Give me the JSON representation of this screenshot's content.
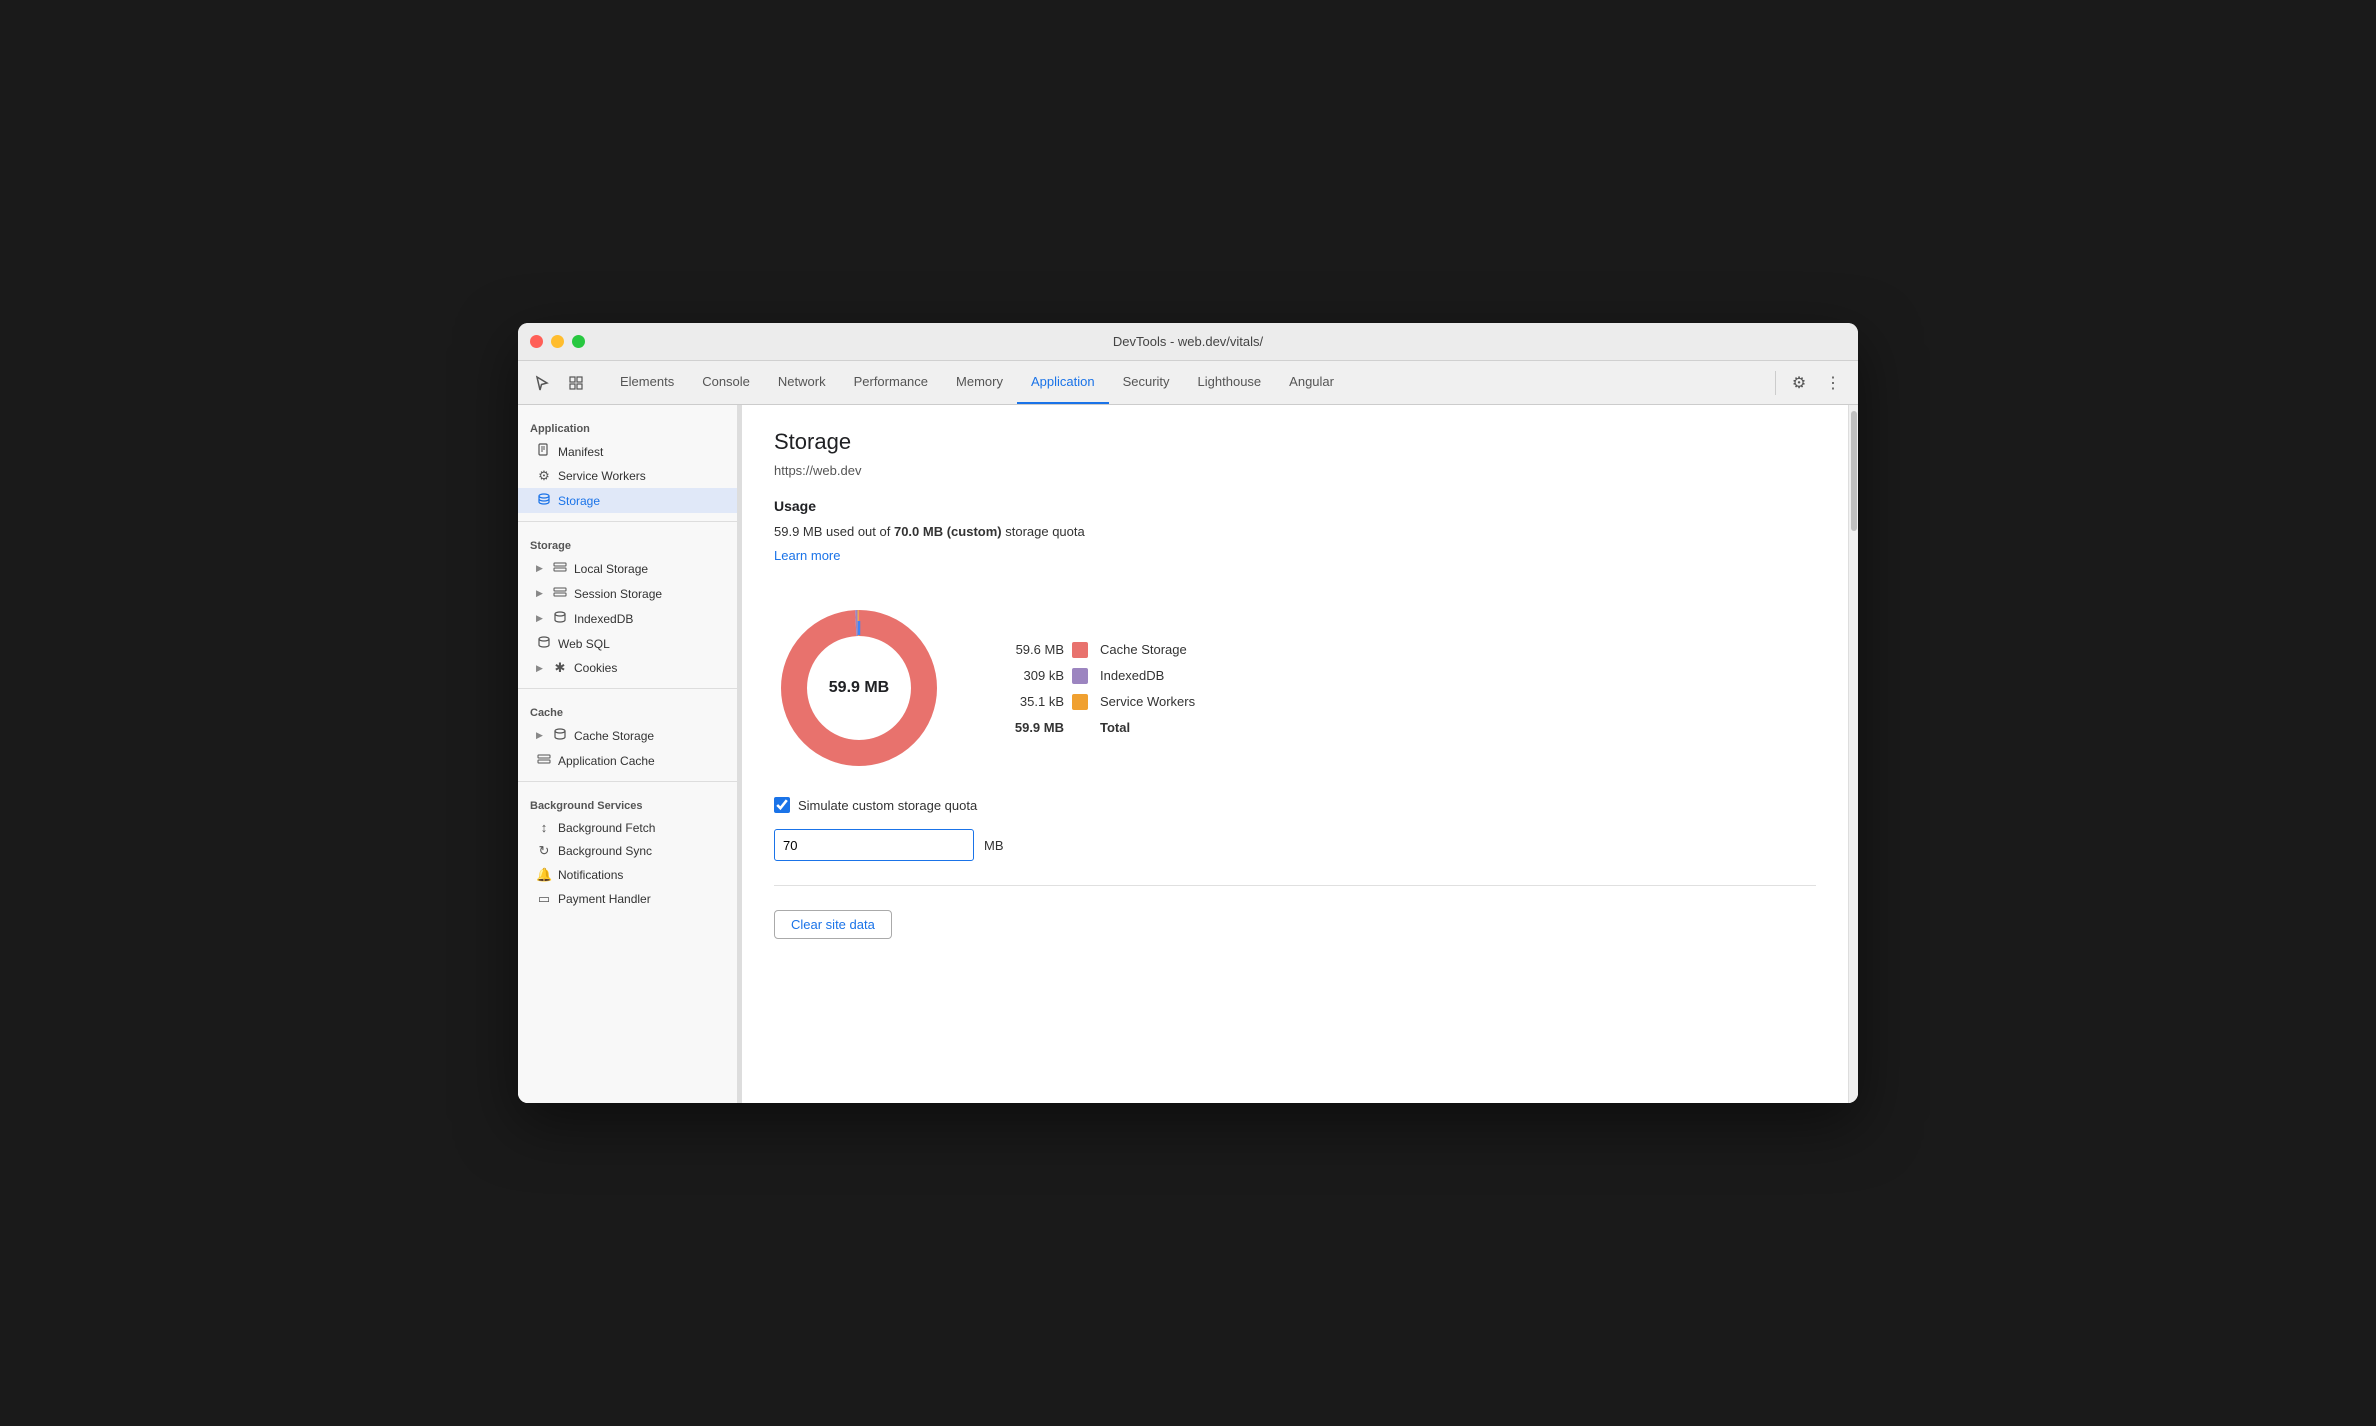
{
  "window": {
    "title": "DevTools - web.dev/vitals/"
  },
  "toolbar": {
    "tabs": [
      {
        "label": "Elements",
        "active": false
      },
      {
        "label": "Console",
        "active": false
      },
      {
        "label": "Network",
        "active": false
      },
      {
        "label": "Performance",
        "active": false
      },
      {
        "label": "Memory",
        "active": false
      },
      {
        "label": "Application",
        "active": true
      },
      {
        "label": "Security",
        "active": false
      },
      {
        "label": "Lighthouse",
        "active": false
      },
      {
        "label": "Angular",
        "active": false
      }
    ]
  },
  "sidebar": {
    "application_label": "Application",
    "manifest_label": "Manifest",
    "service_workers_label": "Service Workers",
    "storage_label": "Storage",
    "storage_section_label": "Storage",
    "local_storage_label": "Local Storage",
    "session_storage_label": "Session Storage",
    "indexeddb_label": "IndexedDB",
    "websql_label": "Web SQL",
    "cookies_label": "Cookies",
    "cache_label": "Cache",
    "cache_storage_label": "Cache Storage",
    "application_cache_label": "Application Cache",
    "background_services_label": "Background Services",
    "background_fetch_label": "Background Fetch",
    "background_sync_label": "Background Sync",
    "notifications_label": "Notifications",
    "payment_handler_label": "Payment Handler"
  },
  "content": {
    "title": "Storage",
    "url": "https://web.dev",
    "usage_title": "Usage",
    "usage_text_pre": "59.9 MB used out of ",
    "usage_bold": "70.0 MB (custom)",
    "usage_text_post": " storage quota",
    "learn_more": "Learn more",
    "donut_label": "59.9 MB",
    "legend": [
      {
        "value": "59.6 MB",
        "color": "#e8726d",
        "name": "Cache Storage"
      },
      {
        "value": "309 kB",
        "color": "#9c85c0",
        "name": "IndexedDB"
      },
      {
        "value": "35.1 kB",
        "color": "#f0a030",
        "name": "Service Workers"
      },
      {
        "value": "59.9 MB",
        "color": "",
        "name": "Total",
        "bold": true
      }
    ],
    "simulate_label": "Simulate custom storage quota",
    "quota_value": "70",
    "quota_unit": "MB",
    "clear_button": "Clear site data"
  },
  "icons": {
    "cursor": "⬡",
    "layers": "⊞",
    "settings": "⚙",
    "more": "⋮",
    "manifest": "📄",
    "service_workers": "⚙",
    "storage": "🗄",
    "local_storage": "⊞",
    "session_storage": "⊞",
    "indexeddb": "🗄",
    "websql": "🗄",
    "cookies": "✱",
    "cache_storage": "🗄",
    "application_cache": "⊞",
    "background_fetch": "↕",
    "background_sync": "↻",
    "notifications": "🔔",
    "payment_handler": "▭"
  }
}
